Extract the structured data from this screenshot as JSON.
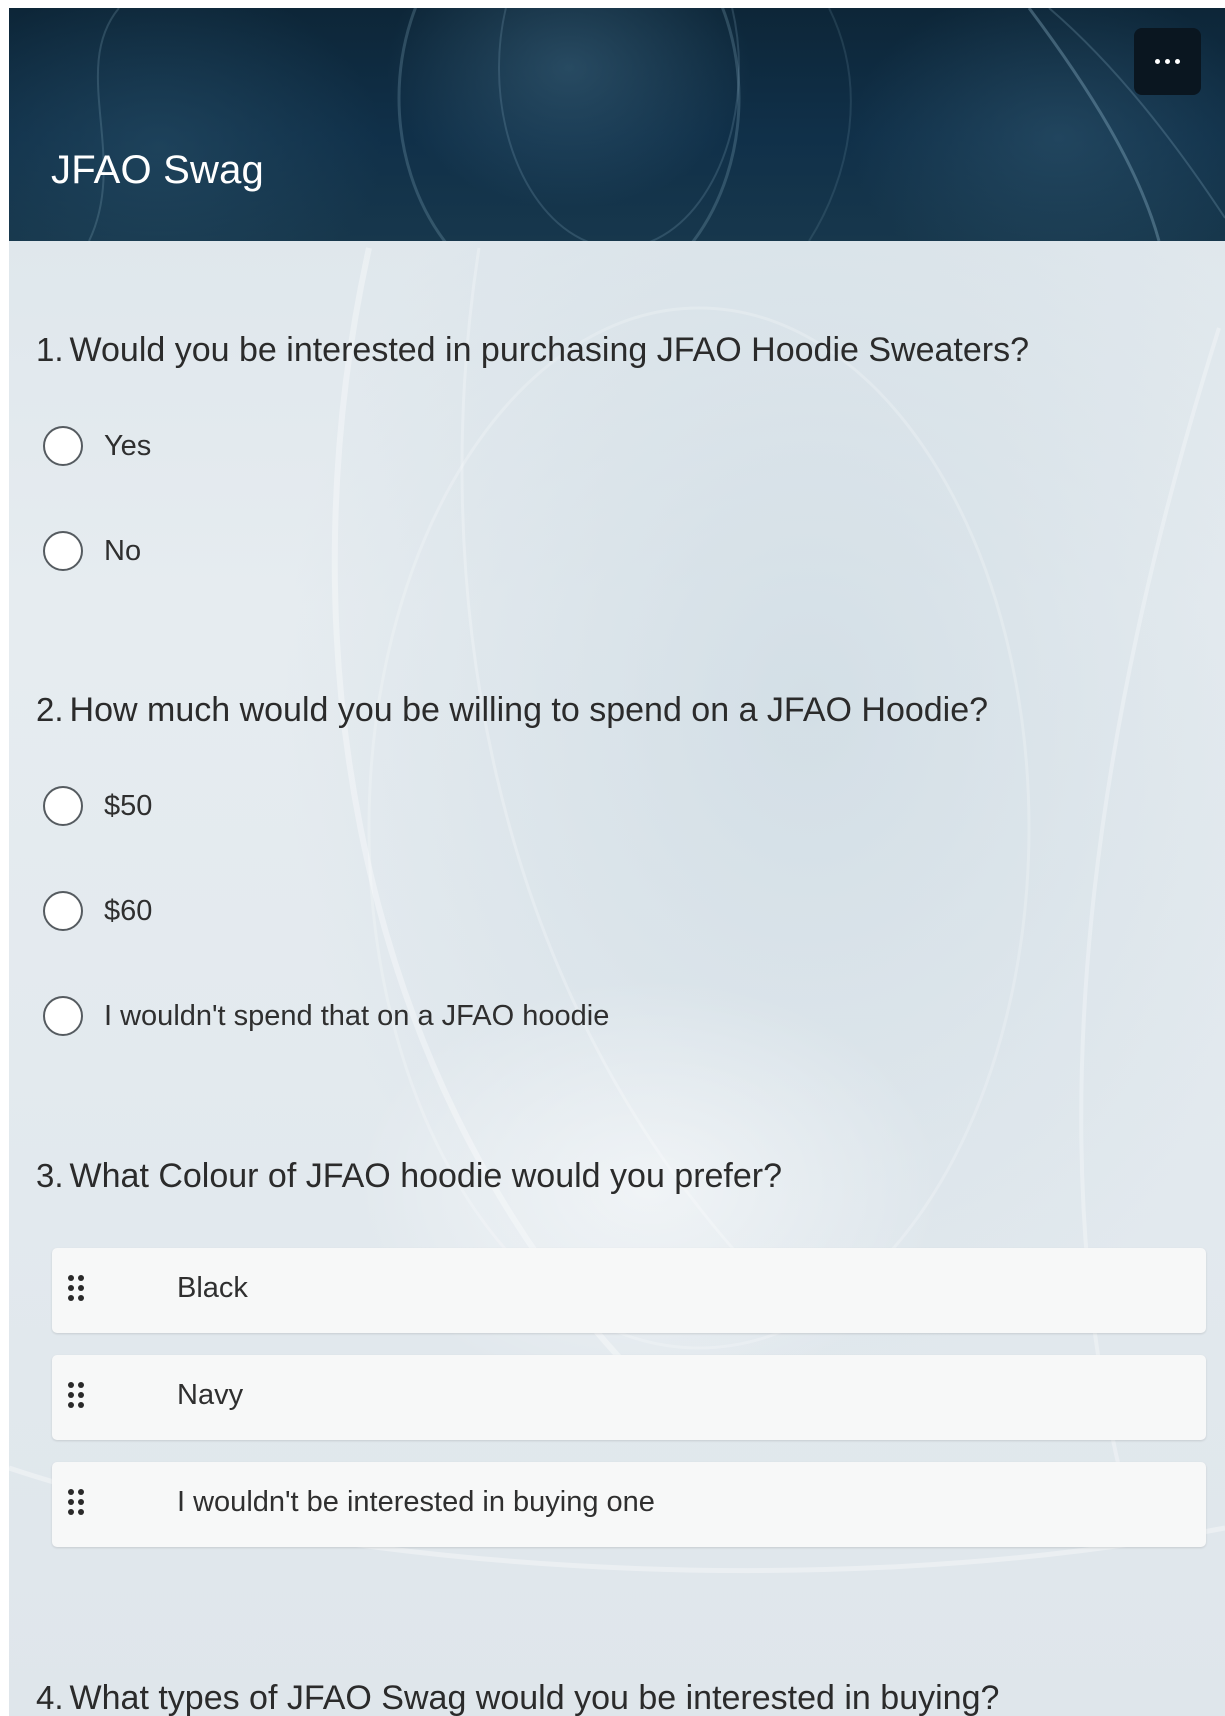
{
  "header": {
    "title": "JFAO Swag",
    "more_icon": "more-horizontal-icon"
  },
  "questions": [
    {
      "number": "1.",
      "title": "Would you be interested in purchasing JFAO Hoodie Sweaters?",
      "type": "radio",
      "options": [
        "Yes",
        "No"
      ]
    },
    {
      "number": "2.",
      "title": "How much would you be willing to spend on a JFAO Hoodie?",
      "type": "radio",
      "options": [
        "$50",
        "$60",
        "I wouldn't spend that on a JFAO hoodie"
      ]
    },
    {
      "number": "3.",
      "title": "What Colour of JFAO hoodie would you prefer?",
      "type": "ranking",
      "options": [
        "Black",
        "Navy",
        "I wouldn't be interested in buying one"
      ],
      "handle_icon": "drag-handle-icon"
    },
    {
      "number": "4.",
      "title": "What types of JFAO Swag would you be interested in buying?"
    }
  ],
  "colors": {
    "header_bg": "#103049",
    "page_bg": "#e2e9ee",
    "text": "#2b2b2b",
    "rank_item_bg": "#f7f8f8"
  }
}
